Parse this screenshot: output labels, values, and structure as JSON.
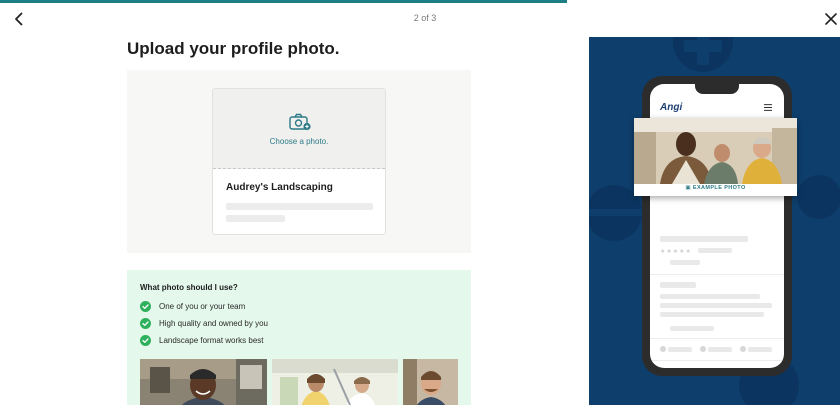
{
  "nav": {
    "step_counter": "2 of 3",
    "progress_fraction": 0.675
  },
  "page": {
    "title": "Upload your profile photo."
  },
  "upload_card": {
    "choose_label": "Choose a photo.",
    "company_name": "Audrey's Landscaping"
  },
  "tips": {
    "heading": "What photo should I use?",
    "items": [
      {
        "label": "One of you or your team"
      },
      {
        "label": "High quality and owned by you"
      },
      {
        "label": "Landscape format works best"
      }
    ]
  },
  "promo": {
    "brand": "Angi",
    "example_caption": "EXAMPLE PHOTO"
  },
  "colors": {
    "accent": "#1d7f86",
    "promo_bg": "#0e3e6b",
    "tips_bg": "#e4f8ec",
    "check_green": "#2fb05d"
  }
}
